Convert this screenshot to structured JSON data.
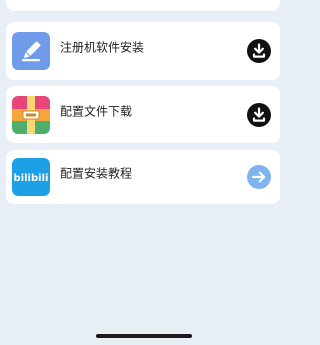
{
  "items": [
    {
      "label": "注册机软件安装",
      "icon": "pencil-app-icon",
      "action": "download-icon"
    },
    {
      "label": "配置文件下载",
      "icon": "archive-app-icon",
      "action": "download-icon"
    },
    {
      "label": "配置安装教程",
      "icon": "bilibili-app-icon",
      "action": "arrow-right-icon",
      "logo_text": "bilibili"
    }
  ],
  "colors": {
    "background": "#e8eef6",
    "pencil_icon_bg": "#6f9be8",
    "download_icon": "#111111",
    "arrow_icon": "#7fb3ee",
    "bilibili_icon_bg": "#1ea0e6"
  }
}
